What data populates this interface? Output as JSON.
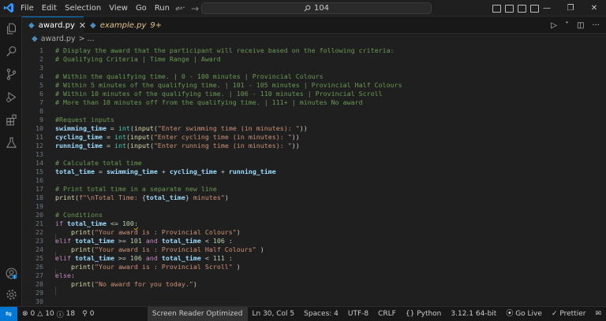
{
  "menu": [
    "File",
    "Edit",
    "Selection",
    "View",
    "Go",
    "Run",
    "···"
  ],
  "search": {
    "text": "104"
  },
  "tabs": [
    {
      "label": "award.py",
      "close": "✕"
    },
    {
      "label": "example.py",
      "badge": "9+"
    }
  ],
  "breadcrumb": {
    "file": "award.py",
    "rest": "> ..."
  },
  "code": [
    {
      "n": "1",
      "t": [
        [
          "cmt",
          "# Display the award that the participant will receive based on the following criteria:"
        ]
      ]
    },
    {
      "n": "2",
      "t": [
        [
          "cmt",
          "# Qualifying Criteria | Time Range | Award"
        ]
      ]
    },
    {
      "n": "3",
      "t": []
    },
    {
      "n": "4",
      "t": [
        [
          "cmt",
          "# Within the qualifying time. | 0 - 100 minutes | Provincial Colours"
        ]
      ]
    },
    {
      "n": "5",
      "t": [
        [
          "cmt",
          "# Within 5 minutes of the qualifying time. | 101 - 105 minutes | Provincial Half Colours"
        ]
      ]
    },
    {
      "n": "6",
      "t": [
        [
          "cmt",
          "# Within 10 minutes of the qualifying time. | 106 - 110 minutes | Provincial Scroll"
        ]
      ]
    },
    {
      "n": "7",
      "t": [
        [
          "cmt",
          "# More than 10 minutes off from the qualifying time. | 111+ | minutes No award"
        ]
      ]
    },
    {
      "n": "8",
      "t": []
    },
    {
      "n": "9",
      "t": [
        [
          "cmt",
          "#Request inputs"
        ]
      ]
    },
    {
      "n": "10",
      "t": [
        [
          "var",
          "swimming_time"
        ],
        [
          "op",
          " = "
        ],
        [
          "cls",
          "int"
        ],
        [
          "op",
          "("
        ],
        [
          "fn",
          "input"
        ],
        [
          "op",
          "("
        ],
        [
          "str",
          "\"Enter swimming time (in minutes): \""
        ],
        [
          "op",
          "))"
        ]
      ]
    },
    {
      "n": "11",
      "t": [
        [
          "var",
          "cycling_time"
        ],
        [
          "op",
          " = "
        ],
        [
          "cls",
          "int"
        ],
        [
          "op",
          "("
        ],
        [
          "fn",
          "input"
        ],
        [
          "op",
          "("
        ],
        [
          "str",
          "\"Enter cycling time (in minutes): \""
        ],
        [
          "op",
          "))"
        ]
      ]
    },
    {
      "n": "12",
      "t": [
        [
          "var",
          "running_time"
        ],
        [
          "op",
          " = "
        ],
        [
          "cls",
          "int"
        ],
        [
          "op",
          "("
        ],
        [
          "fn",
          "input"
        ],
        [
          "op",
          "("
        ],
        [
          "str",
          "\"Enter running time (in minutes): \""
        ],
        [
          "op",
          "))"
        ]
      ]
    },
    {
      "n": "13",
      "t": []
    },
    {
      "n": "14",
      "t": [
        [
          "cmt",
          "# Calculate total time"
        ]
      ]
    },
    {
      "n": "15",
      "t": [
        [
          "var",
          "total_time"
        ],
        [
          "op",
          " = "
        ],
        [
          "var",
          "swimming_time"
        ],
        [
          "op",
          " + "
        ],
        [
          "var",
          "cycling_time"
        ],
        [
          "op",
          " + "
        ],
        [
          "var",
          "running_time"
        ]
      ]
    },
    {
      "n": "16",
      "t": []
    },
    {
      "n": "17",
      "t": [
        [
          "cmt",
          "# Print total time in a separate new line"
        ]
      ]
    },
    {
      "n": "18",
      "t": [
        [
          "fn",
          "print"
        ],
        [
          "op",
          "("
        ],
        [
          "str",
          "f\"\\nTotal Time: "
        ],
        [
          "op",
          "{"
        ],
        [
          "var",
          "total_time"
        ],
        [
          "op",
          "}"
        ],
        [
          "str",
          " minutes\""
        ],
        [
          "op",
          ")"
        ]
      ]
    },
    {
      "n": "19",
      "t": []
    },
    {
      "n": "20",
      "t": [
        [
          "cmt",
          "# Conditions"
        ]
      ]
    },
    {
      "n": "21",
      "t": [
        [
          "kw",
          "if"
        ],
        [
          "op",
          " "
        ],
        [
          "var",
          "total_time"
        ],
        [
          "op",
          " <= "
        ],
        [
          "num",
          "100"
        ],
        [
          "sq",
          ":"
        ]
      ]
    },
    {
      "n": "22",
      "t": [
        [
          "op",
          "    "
        ],
        [
          "fn",
          "print"
        ],
        [
          "op",
          "("
        ],
        [
          "str",
          "\"Your award is : Provincial Colours\""
        ],
        [
          "op",
          ")"
        ]
      ]
    },
    {
      "n": "23",
      "t": [
        [
          "kw",
          "elif"
        ],
        [
          "op",
          " "
        ],
        [
          "var",
          "total_time"
        ],
        [
          "op",
          " >= "
        ],
        [
          "num",
          "101"
        ],
        [
          "op",
          " "
        ],
        [
          "kw",
          "and"
        ],
        [
          "op",
          " "
        ],
        [
          "var",
          "total_time"
        ],
        [
          "op",
          " < "
        ],
        [
          "num",
          "106"
        ],
        [
          "op",
          " :"
        ]
      ]
    },
    {
      "n": "24",
      "t": [
        [
          "op",
          "    "
        ],
        [
          "fn",
          "print"
        ],
        [
          "op",
          "("
        ],
        [
          "str",
          "\"Your award is : Provincial Half Colours\""
        ],
        [
          "op",
          " )"
        ]
      ]
    },
    {
      "n": "25",
      "t": [
        [
          "kw",
          "elif"
        ],
        [
          "op",
          " "
        ],
        [
          "var",
          "total_time"
        ],
        [
          "op",
          " >= "
        ],
        [
          "num",
          "106"
        ],
        [
          "op",
          " "
        ],
        [
          "kw",
          "and"
        ],
        [
          "op",
          " "
        ],
        [
          "var",
          "total_time"
        ],
        [
          "op",
          " < "
        ],
        [
          "num",
          "111"
        ],
        [
          "op",
          " :"
        ]
      ]
    },
    {
      "n": "26",
      "t": [
        [
          "op",
          "    "
        ],
        [
          "fn",
          "print"
        ],
        [
          "op",
          "("
        ],
        [
          "str",
          "\"Your award is : Provincial Scroll\""
        ],
        [
          "op",
          " )"
        ]
      ]
    },
    {
      "n": "27",
      "t": [
        [
          "kw",
          "else"
        ],
        [
          "op",
          ":"
        ]
      ]
    },
    {
      "n": "28",
      "t": [
        [
          "op",
          "    "
        ],
        [
          "fn",
          "print"
        ],
        [
          "op",
          "("
        ],
        [
          "str",
          "\"No award for you today.\""
        ],
        [
          "op",
          ")"
        ]
      ]
    },
    {
      "n": "29",
      "t": []
    },
    {
      "n": "30",
      "t": []
    }
  ],
  "status": {
    "errors": "0",
    "warnings": "10",
    "info": "18",
    "ports": "0",
    "screen_reader": "Screen Reader Optimized",
    "position": "Ln 30, Col 5",
    "spaces": "Spaces: 4",
    "encoding": "UTF-8",
    "eol": "CRLF",
    "language": "Python",
    "interpreter": "3.12.1 64-bit",
    "golive": "Go Live",
    "prettier": "Prettier"
  },
  "colors": {
    "accent": "#0078d4",
    "background": "#1f1f1f",
    "warning_tab": "#e2c08d"
  },
  "icons": [
    "vscode-logo-icon",
    "explorer-icon",
    "search-icon",
    "source-control-icon",
    "run-debug-icon",
    "extensions-icon",
    "testing-icon",
    "account-icon",
    "settings-gear-icon"
  ]
}
